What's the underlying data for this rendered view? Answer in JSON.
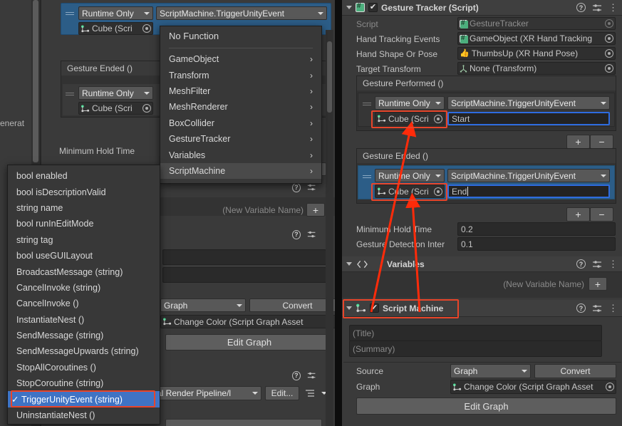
{
  "left_panel": {
    "clipped_text": "enerat",
    "event_row_top": {
      "runtime_mode": "Runtime Only",
      "function": "ScriptMachine.TriggerUnityEvent",
      "object": "Cube (Scri"
    },
    "gesture_ended_title": "Gesture Ended ()",
    "event_row_bottom": {
      "runtime_mode": "Runtime Only",
      "object": "Cube (Scri"
    },
    "minimum_hold_time_label": "Minimum Hold Time",
    "new_variable_placeholder": "(New Variable Name)",
    "add_button": "+",
    "source_value": "Graph",
    "convert_button": "Convert",
    "graph_value": "Change Color (Script Graph Asset",
    "edit_graph_button": "Edit Graph",
    "render_pipeline_value": "al Render Pipeline/l",
    "edit_button": "Edit..."
  },
  "function_menu": {
    "header": "No Function",
    "items": [
      {
        "label": "GameObject",
        "submenu": true
      },
      {
        "label": "Transform",
        "submenu": true
      },
      {
        "label": "MeshFilter",
        "submenu": true
      },
      {
        "label": "MeshRenderer",
        "submenu": true
      },
      {
        "label": "BoxCollider",
        "submenu": true
      },
      {
        "label": "GestureTracker",
        "submenu": true
      },
      {
        "label": "Variables",
        "submenu": true
      },
      {
        "label": "ScriptMachine",
        "submenu": true,
        "highlighted": true
      }
    ]
  },
  "member_menu": {
    "items": [
      {
        "label": "bool enabled",
        "selected": false
      },
      {
        "label": "bool isDescriptionValid",
        "selected": false
      },
      {
        "label": "string name",
        "selected": false
      },
      {
        "label": "bool runInEditMode",
        "selected": false
      },
      {
        "label": "string tag",
        "selected": false
      },
      {
        "label": "bool useGUILayout",
        "selected": false
      },
      {
        "label": "BroadcastMessage (string)",
        "selected": false
      },
      {
        "label": "CancelInvoke (string)",
        "selected": false
      },
      {
        "label": "CancelInvoke ()",
        "selected": false
      },
      {
        "label": "InstantiateNest ()",
        "selected": false
      },
      {
        "label": "SendMessage (string)",
        "selected": false
      },
      {
        "label": "SendMessageUpwards (string)",
        "selected": false
      },
      {
        "label": "StopAllCoroutines ()",
        "selected": false
      },
      {
        "label": "StopCoroutine (string)",
        "selected": false
      },
      {
        "label": "TriggerUnityEvent (string)",
        "selected": true,
        "check": "✓"
      },
      {
        "label": "UninstantiateNest ()",
        "selected": false
      }
    ]
  },
  "inspector": {
    "gesture_tracker": {
      "title": "Gesture Tracker (Script)",
      "enabled": true,
      "fields": [
        {
          "label": "Script",
          "value": "GestureTracker",
          "icon": "script-icon",
          "disabled": true
        },
        {
          "label": "Hand Tracking Events",
          "value": "GameObject (XR Hand Tracking",
          "icon": "script-icon",
          "disabled": false
        },
        {
          "label": "Hand Shape Or Pose",
          "value": "ThumbsUp (XR Hand Pose)",
          "icon": "thumbsup-icon",
          "disabled": false
        },
        {
          "label": "Target Transform",
          "value": "None (Transform)",
          "icon": "transform-icon",
          "disabled": false
        }
      ],
      "gesture_performed": {
        "title": "Gesture Performed ()",
        "runtime_mode": "Runtime Only",
        "function": "ScriptMachine.TriggerUnityEvent",
        "object": "Cube (Scri",
        "argument": "Start",
        "add_label": "+",
        "remove_label": "−"
      },
      "gesture_ended": {
        "title": "Gesture Ended ()",
        "runtime_mode": "Runtime Only",
        "function": "ScriptMachine.TriggerUnityEvent",
        "object": "Cube (Scri",
        "argument": "End",
        "add_label": "+",
        "remove_label": "−"
      },
      "minimum_hold_time": {
        "label": "Minimum Hold Time",
        "value": "0.2"
      },
      "gesture_detection_interval": {
        "label": "Gesture Detection Inter",
        "value": "0.1"
      }
    },
    "variables": {
      "title": "Variables",
      "new_variable_placeholder": "(New Variable Name)",
      "add_label": "+"
    },
    "script_machine": {
      "title": "Script Machine",
      "enabled": true,
      "title_placeholder": "(Title)",
      "summary_placeholder": "(Summary)",
      "source_label": "Source",
      "source_value": "Graph",
      "convert_label": "Convert",
      "graph_label": "Graph",
      "graph_value": "Change Color (Script Graph Asset",
      "edit_graph_label": "Edit Graph"
    }
  },
  "annotations": {
    "highlight_color": "#e8452a",
    "boxes": [
      "gesture-performed-object-field",
      "gesture-ended-object-field",
      "script-machine-header",
      "trigger-unity-event-menu-item"
    ],
    "arrows": [
      "script-machine-to-gesture-performed-object",
      "script-machine-to-gesture-ended-object"
    ]
  },
  "colors": {
    "selection_blue": "#2c5d87",
    "menu_selection_blue": "#3f73c4",
    "focus_border_blue": "#2e6ce0",
    "panel_bg": "#383838",
    "header_bg": "#3f3f3f",
    "field_bg": "#2a2a2a"
  }
}
